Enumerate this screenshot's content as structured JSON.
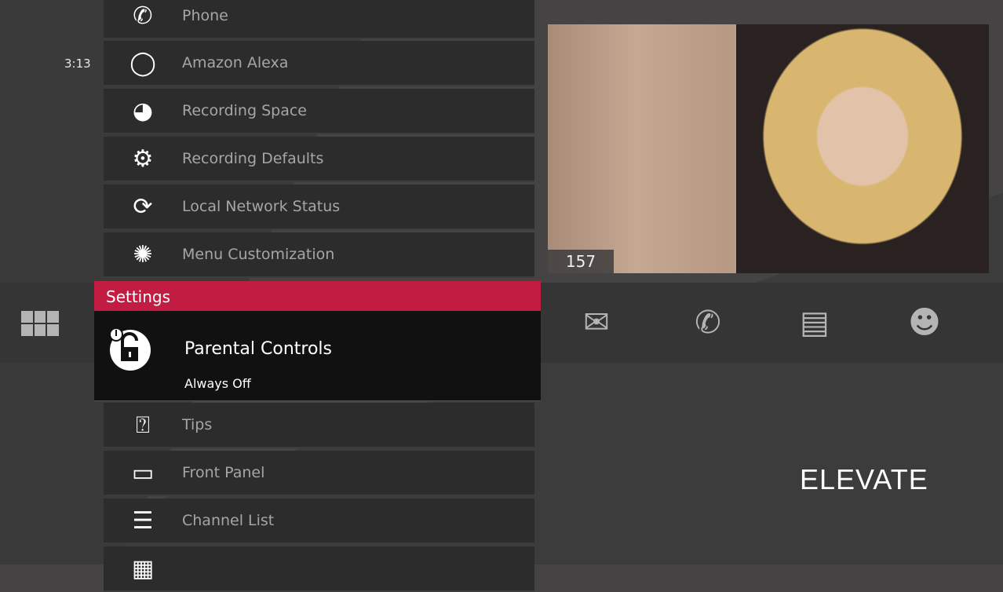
{
  "clock": "3:13",
  "menu_above": [
    {
      "label": "Phone",
      "icon": "phone-icon"
    },
    {
      "label": "Amazon Alexa",
      "icon": "alexa-icon"
    },
    {
      "label": "Recording Space",
      "icon": "recording-space-icon"
    },
    {
      "label": "Recording Defaults",
      "icon": "gear-icon"
    },
    {
      "label": "Local Network Status",
      "icon": "refresh-icon"
    },
    {
      "label": "Menu Customization",
      "icon": "menu-customization-icon"
    }
  ],
  "section_title": "Settings",
  "selected": {
    "label": "Parental Controls",
    "value": "Always Off",
    "icon": "unlocked-padlock-icon"
  },
  "menu_below": [
    {
      "label": "Tips",
      "icon": "tips-box-icon"
    },
    {
      "label": "Front Panel",
      "icon": "front-panel-icon"
    },
    {
      "label": "Channel List",
      "icon": "channel-list-icon"
    },
    {
      "label": "",
      "icon": "guide-icon"
    }
  ],
  "video": {
    "channel": "157"
  },
  "quick_icons": [
    "mail-icon",
    "phone-icon",
    "guide-window-icon",
    "smiley-icon"
  ],
  "brand": "ELEVATE",
  "colors": {
    "accent": "#c31c43"
  }
}
